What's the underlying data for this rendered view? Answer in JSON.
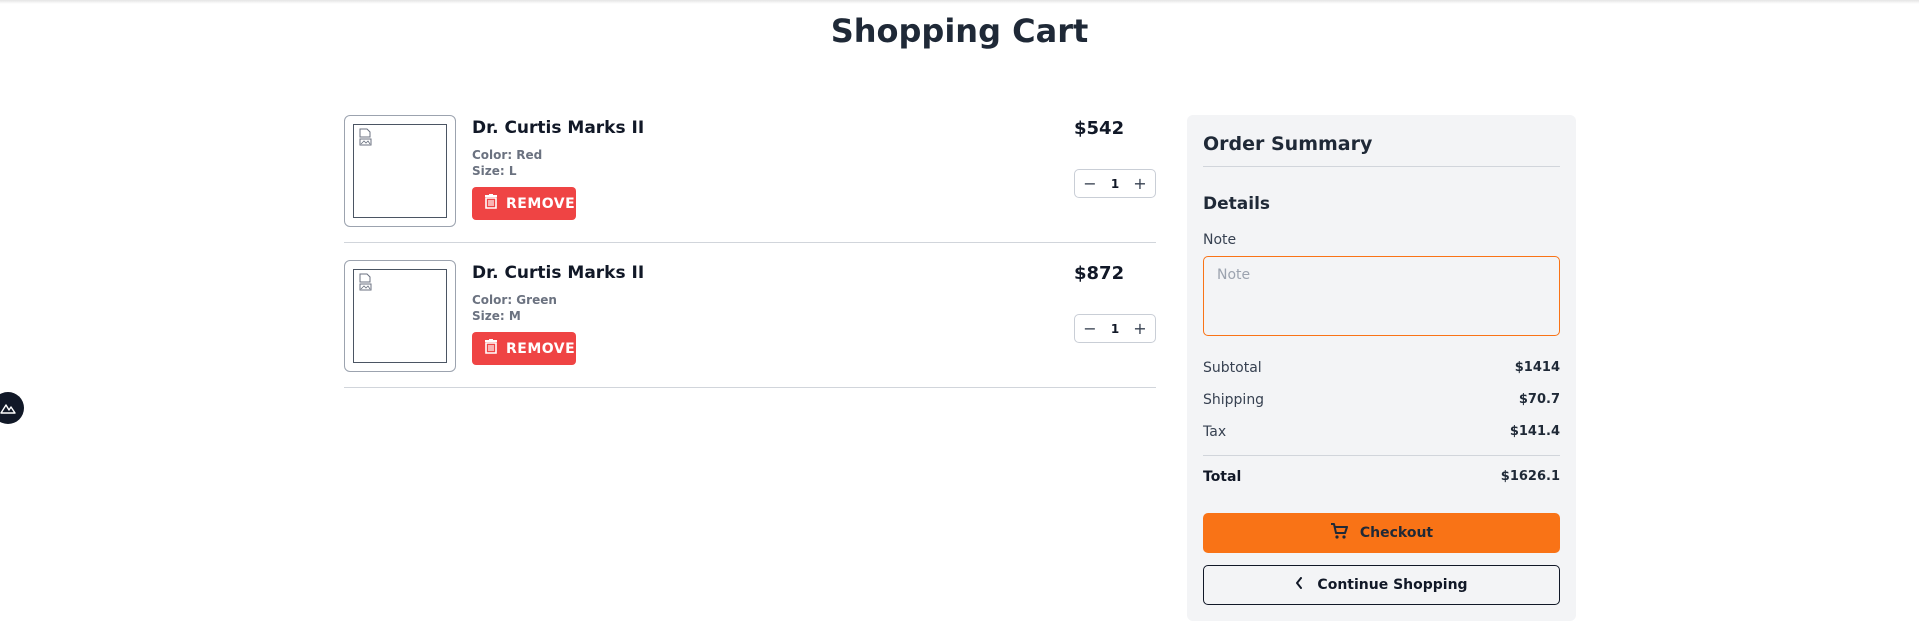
{
  "page": {
    "title": "Shopping Cart"
  },
  "colors": {
    "accent": "#f97316",
    "danger": "#ef4444",
    "panel": "#f3f4f6"
  },
  "cart": {
    "items": [
      {
        "name": "Dr. Curtis Marks II",
        "color": "Color: Red",
        "size": "Size: L",
        "remove_label": "REMOVE",
        "price": "$542",
        "quantity": "1",
        "icons": {
          "image": "broken-image-icon",
          "remove": "trash-icon",
          "minus": "minus-icon",
          "plus": "plus-icon"
        }
      },
      {
        "name": "Dr. Curtis Marks II",
        "color": "Color: Green",
        "size": "Size: M",
        "remove_label": "REMOVE",
        "price": "$872",
        "quantity": "1",
        "icons": {
          "image": "broken-image-icon",
          "remove": "trash-icon",
          "minus": "minus-icon",
          "plus": "plus-icon"
        }
      }
    ]
  },
  "summary": {
    "title": "Order Summary",
    "details_title": "Details",
    "note_label": "Note",
    "note_placeholder": "Note",
    "note_value": "",
    "subtotal_label": "Subtotal",
    "subtotal_value": "$1414",
    "shipping_label": "Shipping",
    "shipping_value": "$70.7",
    "tax_label": "Tax",
    "tax_value": "$141.4",
    "total_label": "Total",
    "total_value": "$1626.1",
    "checkout_label": "Checkout",
    "checkout_icon": "cart-icon",
    "continue_label": "Continue Shopping",
    "continue_icon": "chevron-left-icon"
  },
  "side_badge_icon": "mountain-logo-icon"
}
